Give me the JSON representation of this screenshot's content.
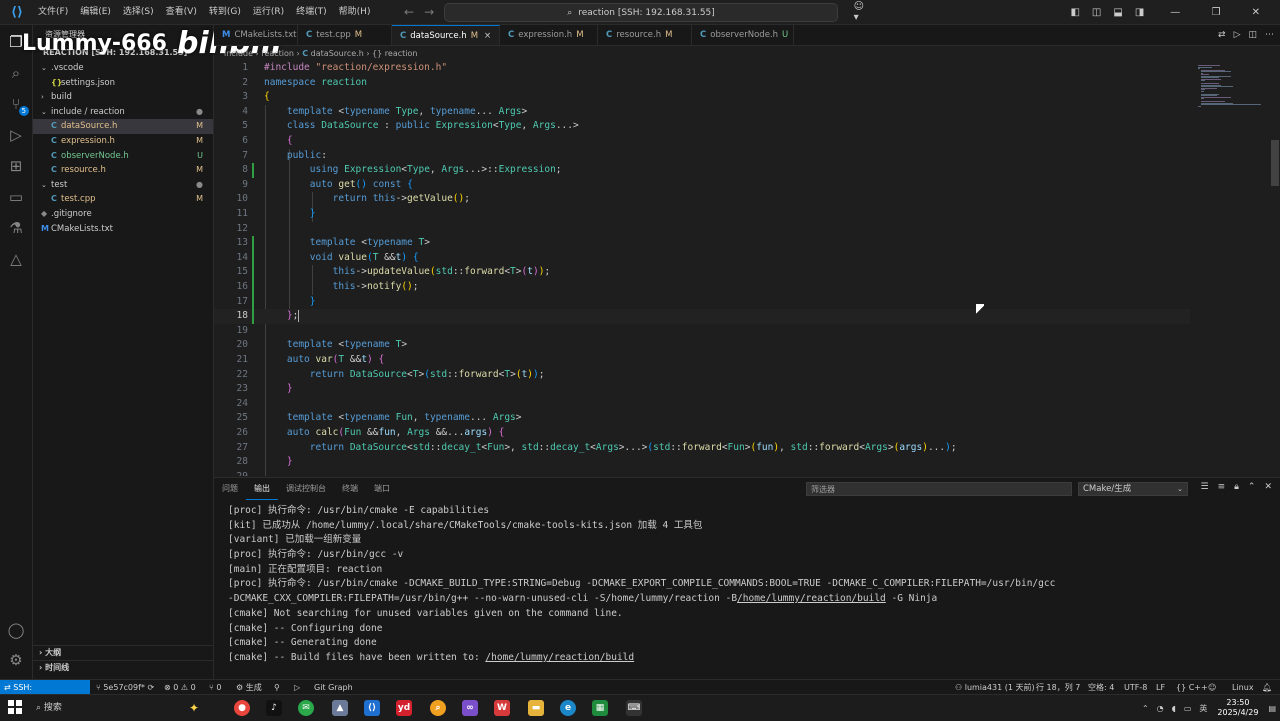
{
  "titlebar": {
    "menus": [
      "文件(F)",
      "编辑(E)",
      "选择(S)",
      "查看(V)",
      "转到(G)",
      "运行(R)",
      "终端(T)",
      "帮助(H)"
    ],
    "search_text": "reaction [SSH: 192.168.31.55]"
  },
  "watermark": {
    "user": "Lummy-666",
    "logo": "bilibili"
  },
  "sidebar": {
    "title": "资源管理器",
    "root": "REACTION [SSH: 192.168.31.55]",
    "items": [
      {
        "label": ".vscode",
        "kind": "folder-open",
        "depth": 1,
        "status": ""
      },
      {
        "label": "settings.json",
        "kind": "json",
        "depth": 2,
        "status": ""
      },
      {
        "label": "build",
        "kind": "folder",
        "depth": 1,
        "status": ""
      },
      {
        "label": "include / reaction",
        "kind": "folder-open",
        "depth": 1,
        "status": "●"
      },
      {
        "label": "dataSource.h",
        "kind": "c",
        "depth": 2,
        "status": "M"
      },
      {
        "label": "expression.h",
        "kind": "c",
        "depth": 2,
        "status": "M"
      },
      {
        "label": "observerNode.h",
        "kind": "c",
        "depth": 2,
        "status": "U"
      },
      {
        "label": "resource.h",
        "kind": "c",
        "depth": 2,
        "status": "M"
      },
      {
        "label": "test",
        "kind": "folder-open",
        "depth": 1,
        "status": "●"
      },
      {
        "label": "test.cpp",
        "kind": "c",
        "depth": 2,
        "status": "M"
      },
      {
        "label": ".gitignore",
        "kind": "git",
        "depth": 1,
        "status": ""
      },
      {
        "label": "CMakeLists.txt",
        "kind": "cmake",
        "depth": 1,
        "status": ""
      }
    ],
    "outline": "大纲",
    "timeline": "时间线",
    "activity_badge": "5"
  },
  "tabs": [
    {
      "label": "CMakeLists.txt",
      "icon": "M",
      "status": ""
    },
    {
      "label": "test.cpp",
      "icon": "C",
      "status": "M"
    },
    {
      "label": "dataSource.h",
      "icon": "C",
      "status": "M",
      "active": true
    },
    {
      "label": "expression.h",
      "icon": "C",
      "status": "M"
    },
    {
      "label": "resource.h",
      "icon": "C",
      "status": "M"
    },
    {
      "label": "observerNode.h",
      "icon": "C",
      "status": "U"
    }
  ],
  "breadcrumb": {
    "folder": "include",
    "folder2": "reaction",
    "file": "dataSource.h",
    "symbol": "{} reaction"
  },
  "code": {
    "current_line": 18
  },
  "panel": {
    "tabs": [
      "问题",
      "输出",
      "调试控制台",
      "终端",
      "端口"
    ],
    "active_tab": "输出",
    "filter_placeholder": "筛选器",
    "channel": "CMake/生成",
    "output": [
      "[proc] 执行命令: /usr/bin/cmake -E capabilities",
      "[kit] 已成功从 /home/lummy/.local/share/CMakeTools/cmake-tools-kits.json 加载 4 工具包",
      "[variant] 已加载一组新变量",
      "[proc] 执行命令: /usr/bin/gcc -v",
      "[main] 正在配置项目: reaction",
      "[proc] 执行命令: /usr/bin/cmake -DCMAKE_BUILD_TYPE:STRING=Debug -DCMAKE_EXPORT_COMPILE_COMMANDS:BOOL=TRUE -DCMAKE_C_COMPILER:FILEPATH=/usr/bin/gcc",
      "-DCMAKE_CXX_COMPILER:FILEPATH=/usr/bin/g++ --no-warn-unused-cli -S/home/lummy/reaction -B/home/lummy/reaction/build -G Ninja",
      "[cmake] Not searching for unused variables given on the command line.",
      "[cmake] -- Configuring done",
      "[cmake] -- Generating done",
      "[cmake] -- Build files have been written to: /home/lummy/reaction/build"
    ]
  },
  "statusbar": {
    "remote": "SSH: 192.168.31.55",
    "branch": "5e57c09f*",
    "problems": "⊗ 0 ⚠ 0",
    "ports": "0",
    "build": "生成",
    "gitgraph": "Git Graph",
    "author": "lumia431 (1 天前)",
    "position": "行 18，列 7",
    "spaces": "空格: 4",
    "encoding": "UTF-8",
    "eol": "LF",
    "language": "{} C++",
    "platform": "Linux"
  },
  "taskbar": {
    "search_label": "搜索",
    "time": "23:50",
    "date": "2025/4/29",
    "ime": "英"
  }
}
